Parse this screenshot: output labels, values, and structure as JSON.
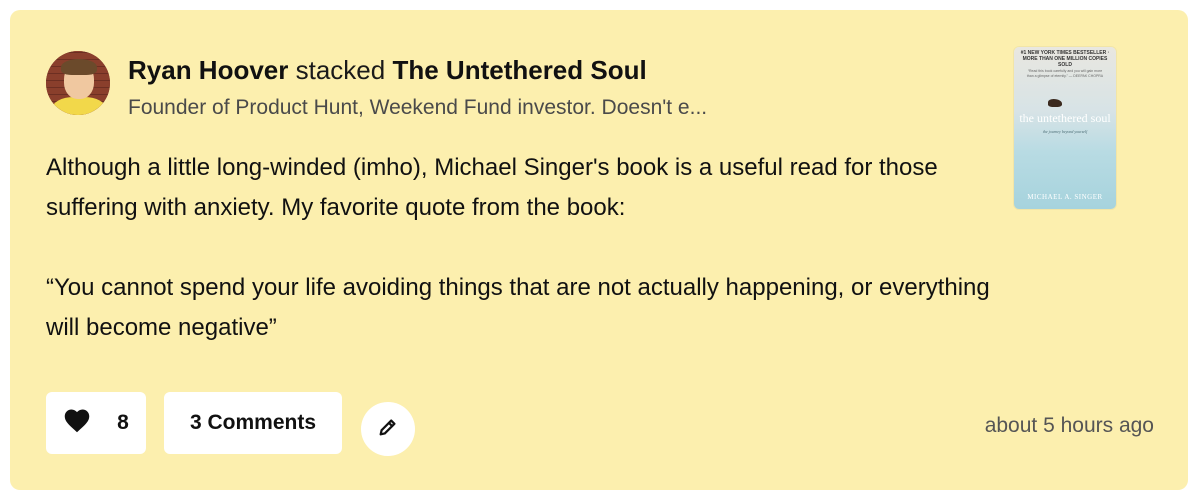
{
  "post": {
    "author_name": "Ryan Hoover",
    "action_verb": "stacked",
    "book_title": "The Untethered Soul",
    "author_bio": "Founder of Product Hunt, Weekend Fund investor. Doesn't e...",
    "body_paragraph_1": "Although a little long-winded (imho), Michael Singer's book is a useful read for those suffering with anxiety. My favorite quote from the book:",
    "body_paragraph_2": "“You cannot spend your life avoiding things that are not actually happening, or everything will become negative”",
    "timestamp": "about 5 hours ago"
  },
  "book_cover": {
    "top_banner": "#1 NEW YORK TIMES BESTSELLER · MORE THAN ONE MILLION COPIES SOLD",
    "quote": "“Read this book carefully and you will gain more than a glimpse of eternity.” — DEEPAK CHOPRA",
    "title": "the untethered soul",
    "subtitle": "the journey beyond yourself",
    "author": "MICHAEL A. SINGER"
  },
  "actions": {
    "like_count": "8",
    "comments_label": "3 Comments"
  },
  "colors": {
    "card_background": "#fcefae",
    "button_background": "#ffffff"
  },
  "icons": {
    "like": "heart-icon",
    "edit": "pencil-icon"
  }
}
